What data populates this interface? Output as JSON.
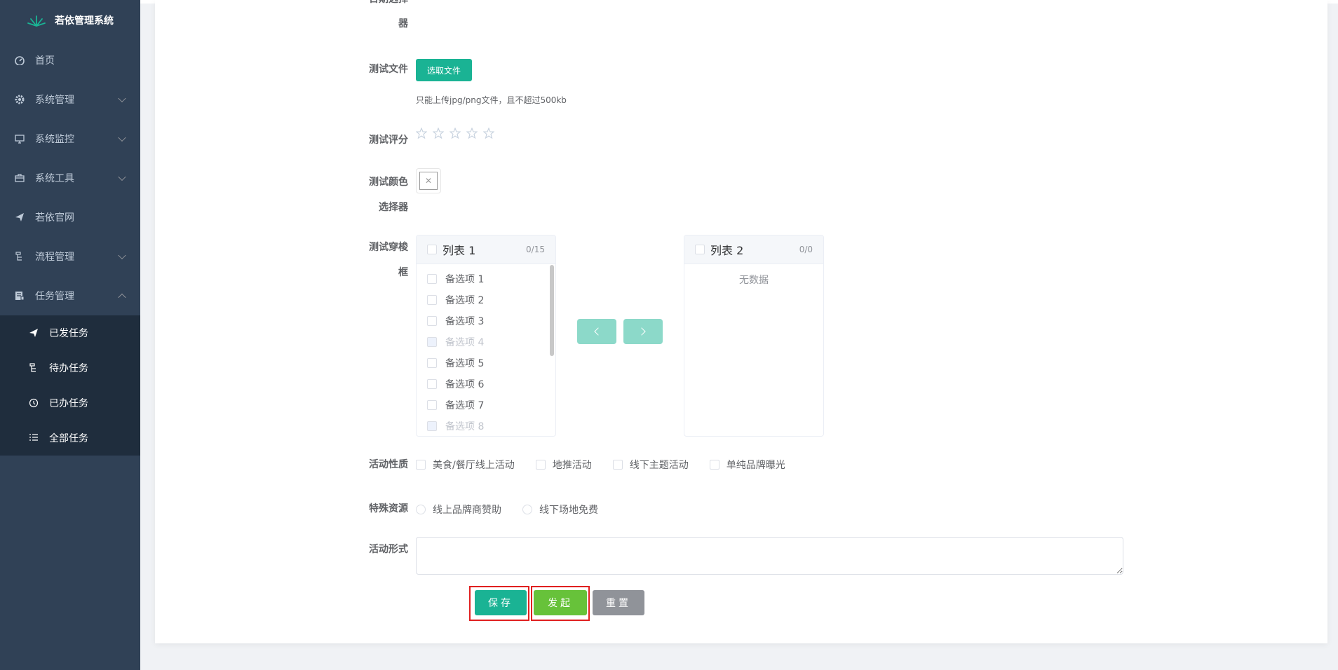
{
  "app": {
    "title": "若依管理系统"
  },
  "sidebar": {
    "items": [
      {
        "label": "首页",
        "icon": "dashboard-icon"
      },
      {
        "label": "系统管理",
        "icon": "gear-icon"
      },
      {
        "label": "系统监控",
        "icon": "monitor-icon"
      },
      {
        "label": "系统工具",
        "icon": "toolbox-icon"
      },
      {
        "label": "若依官网",
        "icon": "send-icon"
      },
      {
        "label": "流程管理",
        "icon": "tree-icon"
      },
      {
        "label": "任务管理",
        "icon": "task-icon"
      }
    ],
    "submenu": [
      {
        "label": "已发任务",
        "icon": "send-icon"
      },
      {
        "label": "待办任务",
        "icon": "tree-icon"
      },
      {
        "label": "已办任务",
        "icon": "history-icon"
      },
      {
        "label": "全部任务",
        "icon": "list-icon"
      }
    ]
  },
  "form": {
    "date_label_line1": "日期选择",
    "date_label_line2": "器",
    "file_label": "测试文件",
    "file_button": "选取文件",
    "file_hint": "只能上传jpg/png文件，且不超过500kb",
    "rate_label": "测试评分",
    "rating_value": 0,
    "color_label_line1": "测试颜色",
    "color_label_line2": "选择器",
    "transfer_label_line1": "测试穿梭",
    "transfer_label_line2": "框",
    "transfer": {
      "left_title": "列表 1",
      "left_count": "0/15",
      "right_title": "列表 2",
      "right_count": "0/0",
      "empty_text": "无数据",
      "items": [
        {
          "label": "备选项 1",
          "disabled": false
        },
        {
          "label": "备选项 2",
          "disabled": false
        },
        {
          "label": "备选项 3",
          "disabled": false
        },
        {
          "label": "备选项 4",
          "disabled": true
        },
        {
          "label": "备选项 5",
          "disabled": false
        },
        {
          "label": "备选项 6",
          "disabled": false
        },
        {
          "label": "备选项 7",
          "disabled": false
        },
        {
          "label": "备选项 8",
          "disabled": true
        }
      ]
    },
    "activity_label": "活动性质",
    "activity_options": [
      "美食/餐厅线上活动",
      "地推活动",
      "线下主题活动",
      "单纯品牌曝光"
    ],
    "resource_label": "特殊资源",
    "resource_options": [
      "线上品牌商赞助",
      "线下场地免费"
    ],
    "form_label": "活动形式",
    "form_value": ""
  },
  "actions": {
    "save": "保存",
    "submit": "发起",
    "reset": "重置"
  },
  "colors": {
    "sidebar_bg": "#304156",
    "submenu_bg": "#1f2d3d",
    "primary": "#1ab394",
    "success": "#67c23a",
    "info": "#909399",
    "highlight": "#e02020"
  }
}
